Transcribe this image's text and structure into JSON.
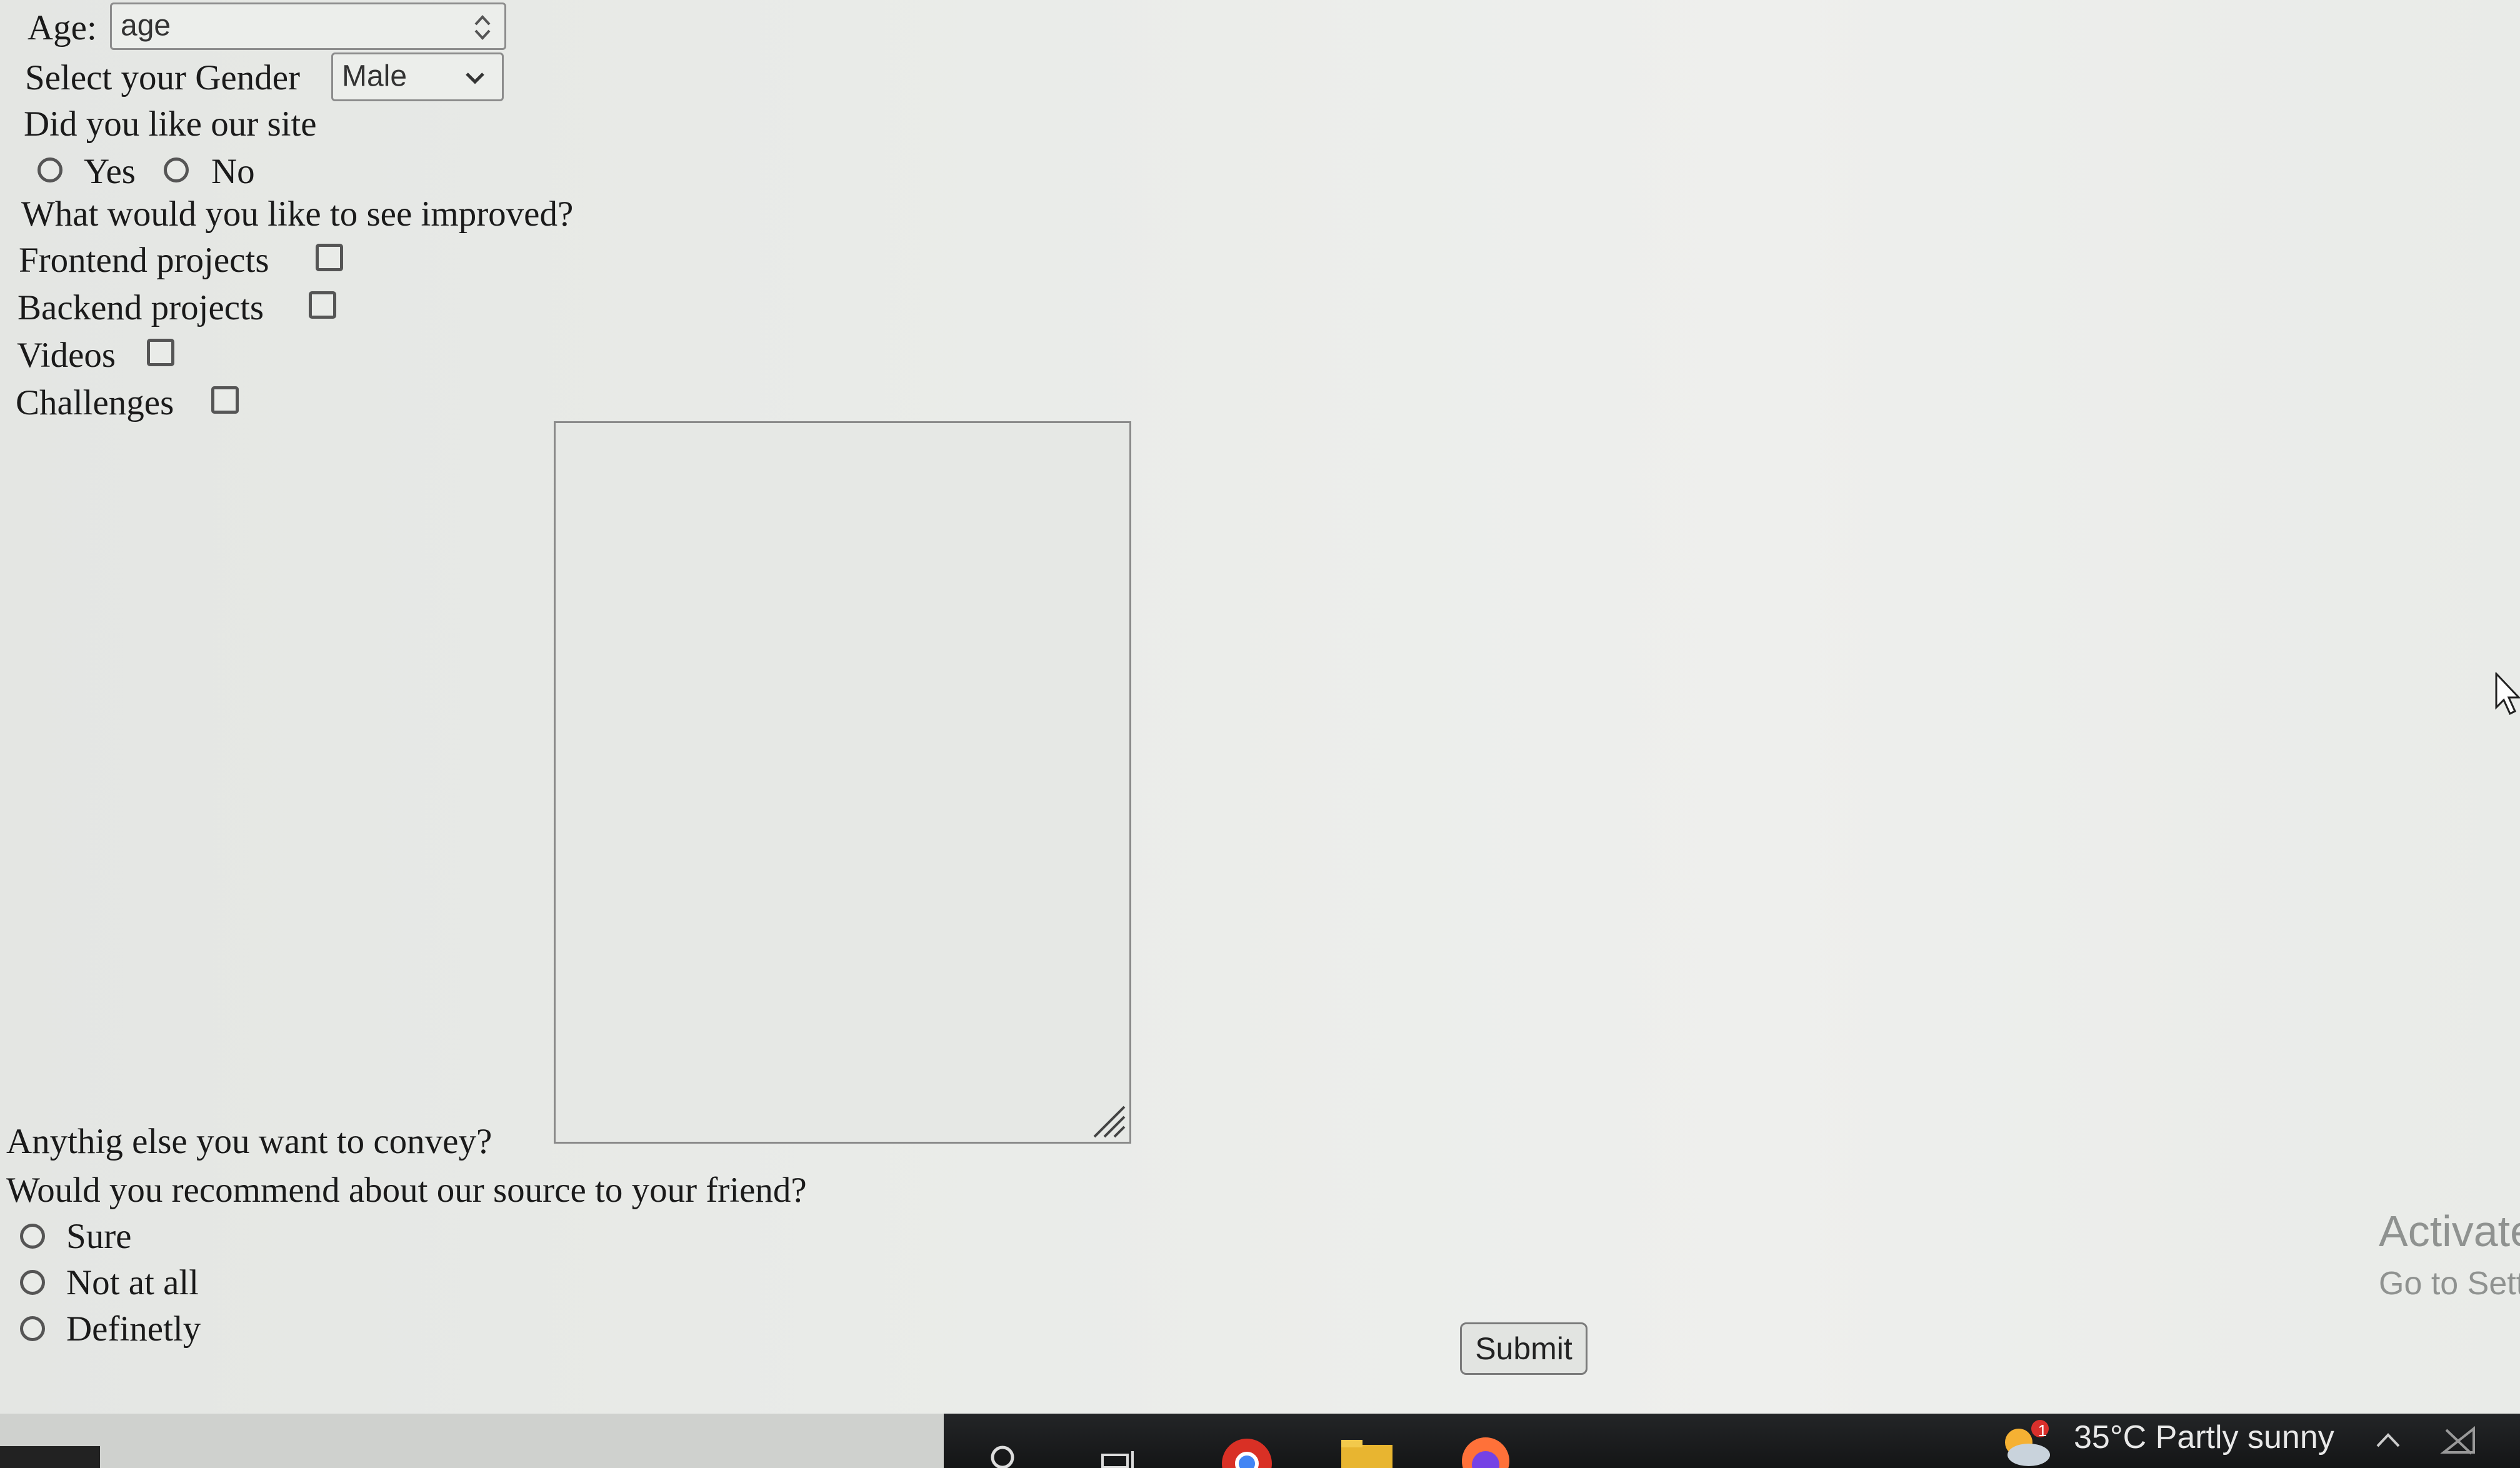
{
  "form": {
    "age_label": "Age:",
    "age_placeholder": "age",
    "gender_label": "Select your Gender",
    "gender_selected": "Male",
    "like_question": "Did you like our site",
    "like_options": [
      "Yes",
      "No"
    ],
    "improve_question": "What would you like to see improved?",
    "improve_options": [
      "Frontend projects",
      "Backend projects",
      "Videos",
      "Challenges"
    ],
    "convey_label": "Anythig else you want to convey?",
    "recommend_question": "Would you recommend about our source to your friend?",
    "recommend_options": [
      "Sure",
      "Not at all",
      "Definetly"
    ],
    "submit_label": "Submit"
  },
  "watermark": {
    "title": "Activate",
    "subtitle": "Go to Sett"
  },
  "taskbar": {
    "weather_text": "35°C  Partly sunny",
    "notification_count": "1",
    "icons": [
      "search-icon",
      "task-view-icon",
      "chrome-icon",
      "file-explorer-icon",
      "firefox-icon",
      "weather-icon",
      "chevron-up-icon",
      "network-icon"
    ]
  }
}
